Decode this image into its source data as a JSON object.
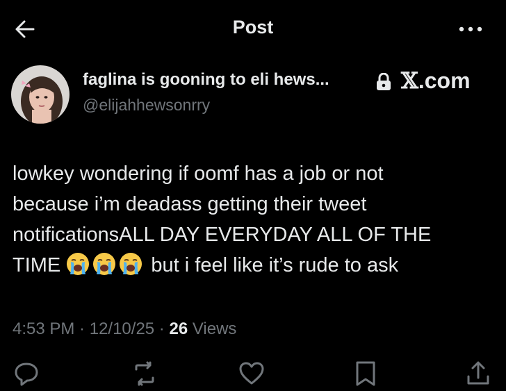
{
  "header": {
    "title": "Post",
    "back_icon": "arrow-left-icon",
    "more_icon": "more-horizontal-icon"
  },
  "author": {
    "display_name": "faglina is gooning to eli hews...",
    "handle": "@elijahhewsonrry",
    "protected_icon": "lock-icon",
    "avatar_icon": "avatar-photo",
    "watermark": {
      "glyph": "𝕏",
      "text": ".com"
    }
  },
  "post": {
    "lines": [
      "lowkey wondering if oomf has a job or not",
      "because i’m deadass getting their tweet",
      "notificationsALL DAY EVERYDAY ALL OF THE",
      "TIME",
      "but i feel like it’s rude to ask"
    ],
    "emoji": [
      "loudly-crying-face",
      "loudly-crying-face",
      "loudly-crying-face"
    ]
  },
  "meta": {
    "time": "4:53 PM",
    "separator1": " · ",
    "date": "12/10/25",
    "separator2": " · ",
    "views_count": "26",
    "views_label": " Views"
  },
  "actions": [
    {
      "name": "reply",
      "icon": "reply-icon"
    },
    {
      "name": "repost",
      "icon": "repost-icon"
    },
    {
      "name": "like",
      "icon": "heart-icon"
    },
    {
      "name": "bookmark",
      "icon": "bookmark-icon"
    },
    {
      "name": "share",
      "icon": "share-icon"
    }
  ],
  "colors": {
    "background": "#000000",
    "primary_text": "#e7e9ea",
    "secondary_text": "#71767b"
  }
}
